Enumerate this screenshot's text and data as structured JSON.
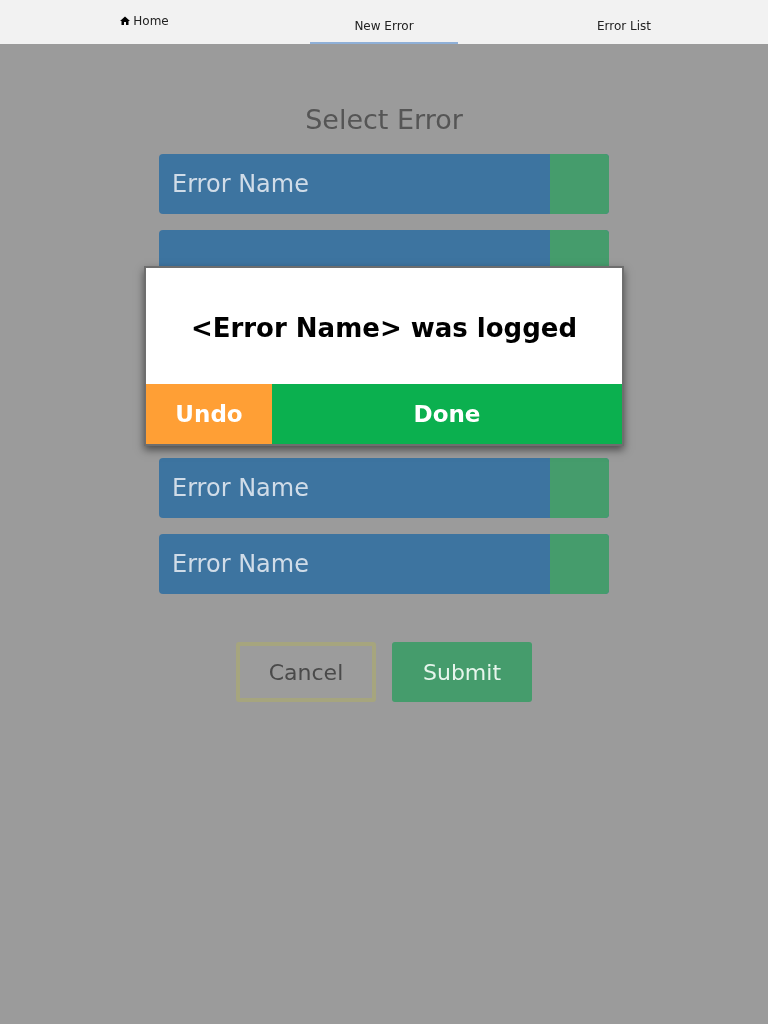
{
  "nav": [
    {
      "label": "Home",
      "kind": "icon",
      "selected": false
    },
    {
      "label": "New Error",
      "kind": "text",
      "selected": true
    },
    {
      "label": "Error List",
      "kind": "text",
      "selected": false
    }
  ],
  "page": {
    "title": "Select Error",
    "rows": [
      {
        "kind": "option",
        "label": "Error Name"
      },
      {
        "kind": "covered"
      },
      {
        "kind": "option",
        "label": "Error Name"
      },
      {
        "kind": "option",
        "label": "Error Name"
      }
    ],
    "buttons": [
      {
        "label": "Cancel",
        "kind": "outline"
      },
      {
        "label": "Submit",
        "kind": "primary"
      }
    ]
  },
  "dialog": {
    "message": "<Error Name> was logged",
    "buttons": [
      {
        "label": "Undo",
        "kind": "warning"
      },
      {
        "label": "Done",
        "kind": "success"
      }
    ]
  }
}
